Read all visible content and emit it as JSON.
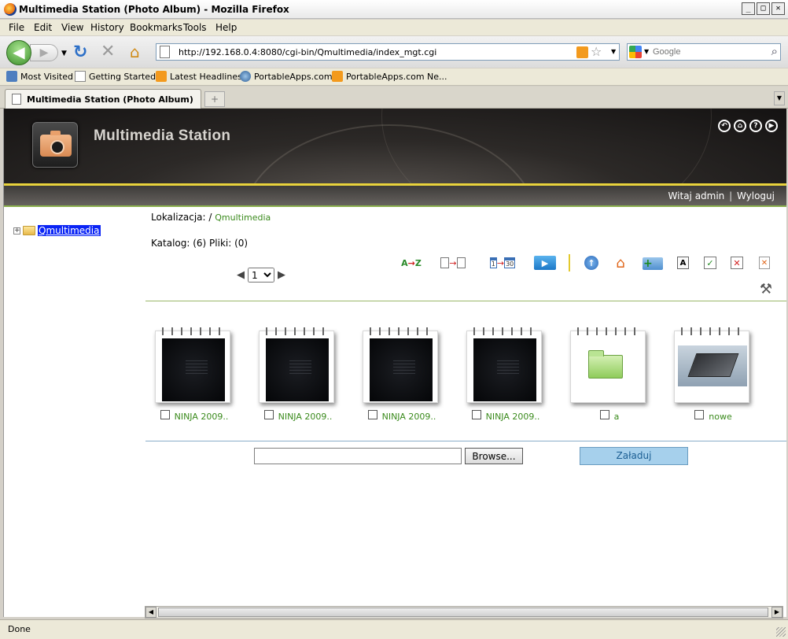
{
  "window": {
    "title": "Multimedia Station (Photo Album) - Mozilla Firefox",
    "controls": [
      "minimize",
      "maximize",
      "close"
    ]
  },
  "menu": [
    "File",
    "Edit",
    "View",
    "History",
    "Bookmarks",
    "Tools",
    "Help"
  ],
  "nav": {
    "url": "http://192.168.0.4:8080/cgi-bin/Qmultimedia/index_mgt.cgi",
    "search_placeholder": "Google"
  },
  "bookmarks": [
    {
      "label": "Most Visited",
      "icon": "folder-icon"
    },
    {
      "label": "Getting Started",
      "icon": "page-icon"
    },
    {
      "label": "Latest Headlines",
      "icon": "rss-icon"
    },
    {
      "label": "PortableApps.com",
      "icon": "globe-icon"
    },
    {
      "label": "PortableApps.com Ne...",
      "icon": "rss-icon"
    }
  ],
  "tab": {
    "title": "Multimedia Station (Photo Album)"
  },
  "app": {
    "name": "Multimedia Station",
    "user": {
      "greeting": "Witaj admin",
      "separator": "|",
      "logout": "Wyloguj"
    }
  },
  "tree": {
    "root": "Qmultimedia"
  },
  "location": {
    "label": "Lokalizacja:",
    "separator": "/",
    "current": "Qmultimedia"
  },
  "counts": {
    "text": "Katalog: (6) Pliki: (0)"
  },
  "pager": {
    "current_page": "1"
  },
  "toolbar_icons": [
    "sort-az-icon",
    "sort-pages-icon",
    "sort-dates-icon",
    "slideshow-icon",
    "up-folder-icon",
    "home-icon",
    "new-folder-icon",
    "rename-icon",
    "select-all-icon",
    "deselect-all-icon",
    "delete-icon",
    "tools-icon"
  ],
  "items": [
    {
      "name": "NINJA 2009..",
      "thumb": "dark"
    },
    {
      "name": "NINJA 2009..",
      "thumb": "dark"
    },
    {
      "name": "NINJA 2009..",
      "thumb": "dark"
    },
    {
      "name": "NINJA 2009..",
      "thumb": "dark"
    },
    {
      "name": "a",
      "thumb": "folder"
    },
    {
      "name": "nowe",
      "thumb": "hdd"
    }
  ],
  "upload": {
    "browse_label": "Browse...",
    "submit_label": "Załaduj"
  },
  "status": {
    "text": "Done"
  }
}
